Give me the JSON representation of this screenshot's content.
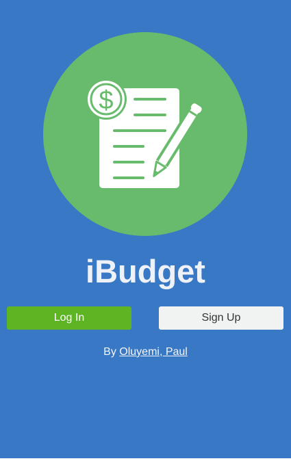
{
  "app": {
    "title": "iBudget",
    "logo_icon": "budget-document-dollar-pencil-icon"
  },
  "actions": {
    "login_label": "Log In",
    "signup_label": "Sign Up"
  },
  "credit": {
    "prefix": "By",
    "author": "Oluyemi, Paul"
  },
  "colors": {
    "background": "#3878c5",
    "logo_circle": "#68bb6c",
    "login_button": "#5db523",
    "signup_button": "#f1f2f2"
  }
}
